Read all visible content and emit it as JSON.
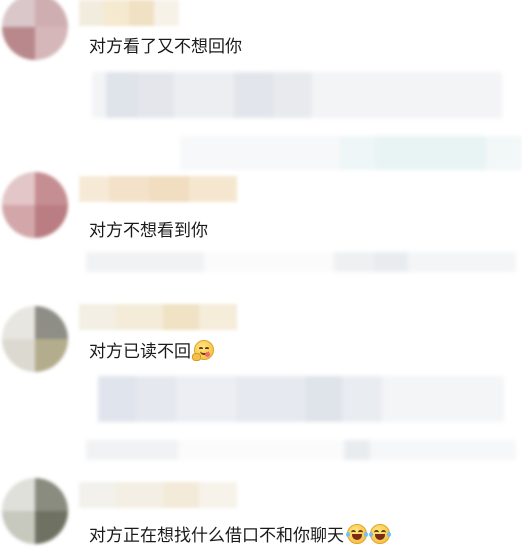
{
  "comments": [
    {
      "text": "对方看了又不想回你",
      "emojis": []
    },
    {
      "text": "对方不想看到你",
      "emojis": []
    },
    {
      "text": "对方已读不回",
      "emojis": [
        "savoring-face-emoji"
      ]
    },
    {
      "text": "对方正在想找什么借口不和你聊天",
      "emojis": [
        "tears-of-joy-emoji",
        "tears-of-joy-emoji"
      ]
    }
  ]
}
